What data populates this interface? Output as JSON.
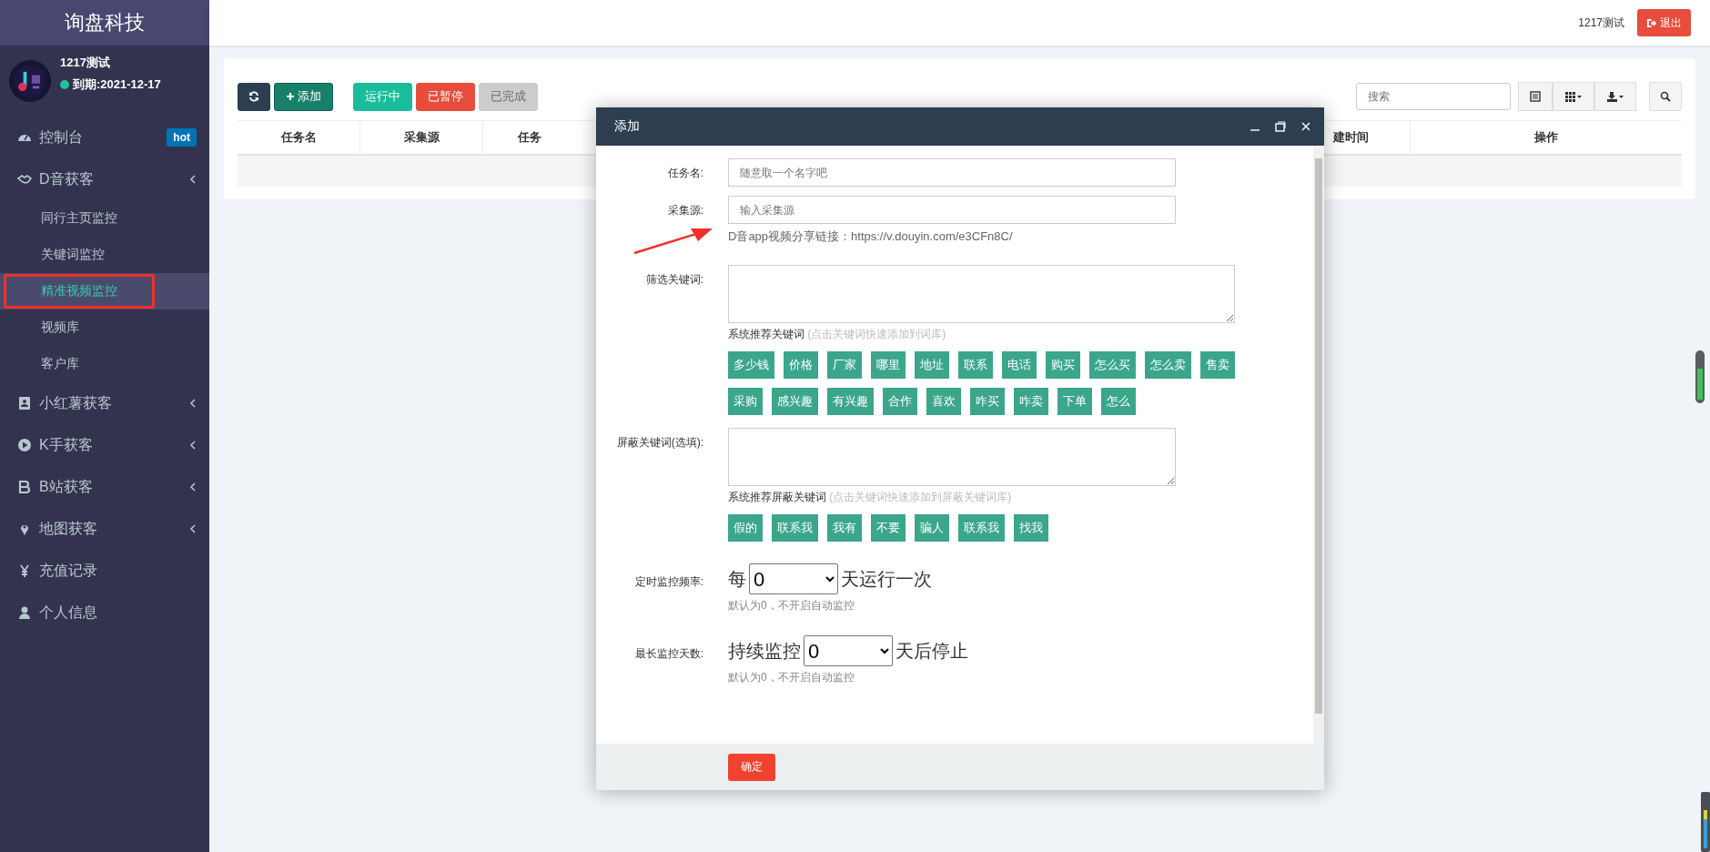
{
  "sidebar": {
    "brand": "询盘科技",
    "user": {
      "name": "1217测试",
      "online": true,
      "expiry": "到期:2021-12-17"
    },
    "menu": [
      {
        "label": "控制台",
        "badge": "hot",
        "collapsible": false,
        "selected": false
      },
      {
        "label": "D音获客",
        "collapsible": true,
        "selected": false,
        "children": [
          {
            "label": "同行主页监控",
            "selected": false,
            "highlighted": false
          },
          {
            "label": "关键词监控",
            "selected": false,
            "highlighted": false
          },
          {
            "label": "精准视频监控",
            "selected": true,
            "highlighted": true
          },
          {
            "label": "视频库",
            "selected": false,
            "highlighted": false
          },
          {
            "label": "客户库",
            "selected": false,
            "highlighted": false
          }
        ]
      },
      {
        "label": "小红薯获客",
        "collapsible": true,
        "selected": false
      },
      {
        "label": "K手获客",
        "collapsible": true,
        "selected": false
      },
      {
        "label": "B站获客",
        "collapsible": true,
        "selected": false
      },
      {
        "label": "地图获客",
        "collapsible": true,
        "selected": false
      },
      {
        "label": "充值记录",
        "collapsible": false,
        "selected": false
      },
      {
        "label": "个人信息",
        "collapsible": false,
        "selected": false
      }
    ]
  },
  "header": {
    "username": "1217测试",
    "logout": "退出"
  },
  "toolbar": {
    "add": "添加",
    "filters": [
      {
        "label": "运行中",
        "color": "#1abc9c",
        "disabled": false
      },
      {
        "label": "已暂停",
        "color": "#e74c3c",
        "disabled": false
      },
      {
        "label": "已完成",
        "color": "#cccccc",
        "disabled": true
      }
    ],
    "search_placeholder": "搜索"
  },
  "table": {
    "columns": [
      {
        "label": "任务名"
      },
      {
        "label": "采集源"
      },
      {
        "label": "任务"
      },
      {
        "label": "建时间"
      },
      {
        "label": "操作"
      }
    ]
  },
  "dialog": {
    "title": "添加",
    "fields": [
      {
        "kind": "input",
        "label": "任务名:",
        "placeholder": "随意取一个名字吧"
      },
      {
        "kind": "input",
        "label": "采集源:",
        "placeholder": "输入采集源",
        "hint": "D音app视频分享链接：https://v.douyin.com/e3CFn8C/",
        "marked": true
      },
      {
        "kind": "textarea",
        "label": "筛选关键词:",
        "suggest_title": "系统推荐关键词",
        "suggest_note": "(点击关键词快速添加到词库)",
        "tags": [
          "多少钱",
          "价格",
          "厂家",
          "哪里",
          "地址",
          "联系",
          "电话",
          "购买",
          "怎么买",
          "怎么卖",
          "售卖",
          "采购",
          "感兴趣",
          "有兴趣",
          "合作",
          "喜欢",
          "咋买",
          "咋卖",
          "下单",
          "怎么"
        ]
      },
      {
        "kind": "textarea",
        "label": "屏蔽关键词(选填):",
        "suggest_title": "系统推荐屏蔽关键词",
        "suggest_note": "(点击关键词快速添加到屏蔽关键词库)",
        "tags": [
          "假的",
          "联系我",
          "我有",
          "不要",
          "骗人",
          "联系我",
          "找我"
        ]
      },
      {
        "kind": "select",
        "label": "定时监控频率:",
        "prefix": "每",
        "value": "0",
        "suffix": "天运行一次",
        "note": "默认为0，不开启自动监控"
      },
      {
        "kind": "select",
        "label": "最长监控天数:",
        "prefix": "持续监控",
        "value": "0",
        "suffix": "天后停止",
        "note": "默认为0，不开启自动监控"
      }
    ],
    "submit": "确定"
  }
}
